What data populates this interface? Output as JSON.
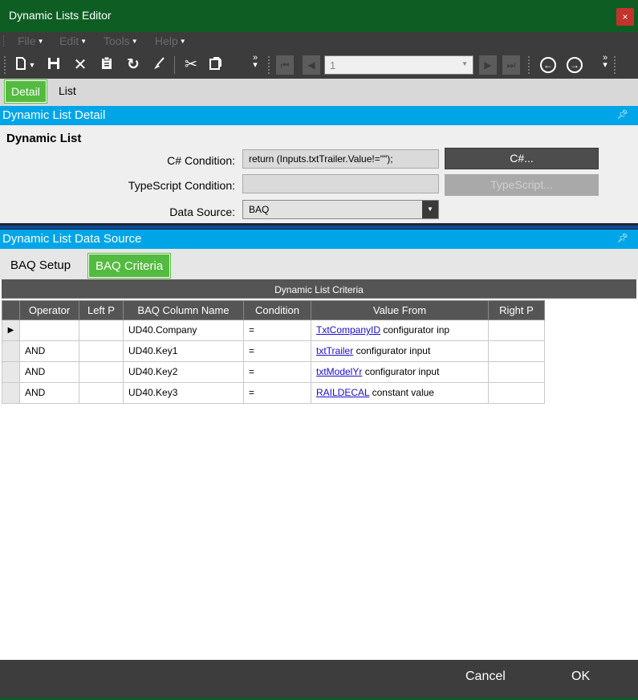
{
  "window": {
    "title": "Dynamic Lists Editor",
    "close_glyph": "×"
  },
  "menu": {
    "items": [
      "File",
      "Edit",
      "Tools",
      "Help"
    ]
  },
  "toolbar": {
    "icons": [
      "new-icon",
      "save-icon",
      "delete-icon",
      "clipboard-icon",
      "refresh-icon",
      "clear-icon",
      "cut-icon",
      "paste-icon"
    ],
    "record_value": "1"
  },
  "tabs": [
    {
      "label": "Detail",
      "active": true
    },
    {
      "label": "List",
      "active": false
    }
  ],
  "detail": {
    "section_title": "Dynamic List Detail",
    "heading": "Dynamic List",
    "csharp_label": "C# Condition:",
    "csharp_value": "return (Inputs.txtTrailer.Value!=\"\");",
    "csharp_button": "C#...",
    "ts_label": "TypeScript Condition:",
    "ts_value": "",
    "ts_button": "TypeScript...",
    "ds_label": "Data Source:",
    "ds_value": "BAQ"
  },
  "datasource": {
    "section_title": "Dynamic List Data Source",
    "tabs": [
      {
        "label": "BAQ Setup",
        "active": false
      },
      {
        "label": "BAQ Criteria",
        "active": true
      }
    ],
    "grid_caption": "Dynamic List Criteria",
    "columns": [
      "Operator",
      "Left P",
      "BAQ Column Name",
      "Condition",
      "Value From",
      "Right P"
    ],
    "rows": [
      {
        "operator": "",
        "left_p": "",
        "column": "UD40.Company",
        "condition": "=",
        "link": "TxtCompanyID",
        "from": "configurator inp",
        "right_p": "",
        "current": true
      },
      {
        "operator": "AND",
        "left_p": "",
        "column": "UD40.Key1",
        "condition": "=",
        "link": "txtTrailer",
        "from": "configurator input",
        "right_p": "",
        "current": false
      },
      {
        "operator": "AND",
        "left_p": "",
        "column": "UD40.Key2",
        "condition": "=",
        "link": "txtModelYr",
        "from": "configurator input",
        "right_p": "",
        "current": false
      },
      {
        "operator": "AND",
        "left_p": "",
        "column": "UD40.Key3",
        "condition": "=",
        "link": "RAILDECAL",
        "from": "constant value",
        "right_p": "",
        "current": false
      }
    ]
  },
  "footer": {
    "cancel": "Cancel",
    "ok": "OK"
  },
  "colors": {
    "title_bar": "#0e5e23",
    "accent_green": "#53bb3f",
    "section_blue": "#00a5e8",
    "dark": "#3c3c3c"
  }
}
